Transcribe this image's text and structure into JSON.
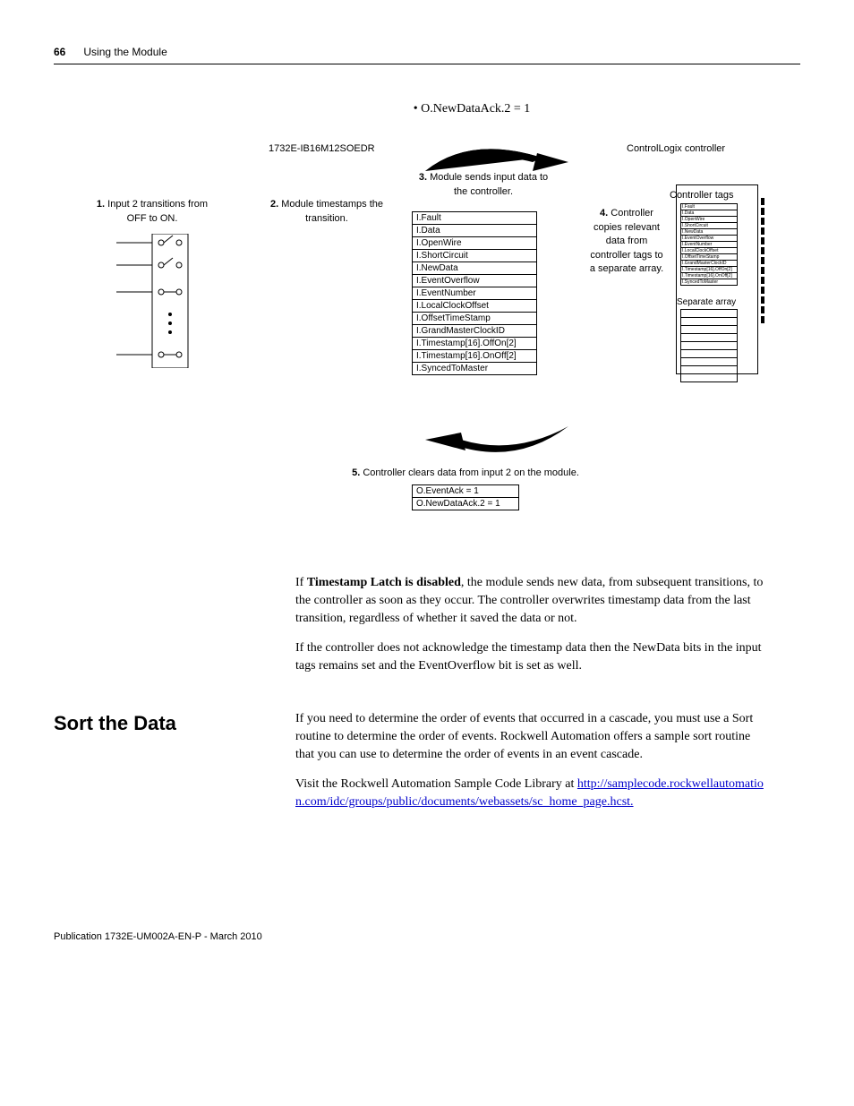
{
  "header": {
    "pagenum": "66",
    "running": "Using the Module"
  },
  "bullet": "• O.NewDataAck.2 = 1",
  "diagram": {
    "module_label": "1732E-IB16M12SOEDR",
    "controller_label": "ControlLogix controller",
    "step1_num": "1.",
    "step1_text": "Input 2 transitions from OFF to ON.",
    "step2_num": "2.",
    "step2_text": "Module timestamps the transition.",
    "step3_num": "3.",
    "step3_text": "Module sends input data to the controller.",
    "step4_num": "4.",
    "step4_text": "Controller copies relevant data from controller tags to a separate array.",
    "step5_num": "5.",
    "step5_text": "Controller clears data from input 2 on the module.",
    "input_tags": [
      "I.Fault",
      "I.Data",
      "I.OpenWire",
      "I.ShortCircuit",
      "I.NewData",
      "I.EventOverflow",
      "I.EventNumber",
      "I.LocalClockOffset",
      "I.OffsetTimeStamp",
      "I.GrandMasterClockID",
      "I.Timestamp[16].OffOn[2]",
      "I.Timestamp[16].OnOff[2]",
      "I.SyncedToMaster"
    ],
    "controller_tags_heading": "Controller tags",
    "controller_tags_small": [
      "I.Fault",
      "I.Data",
      "I.OpenWire",
      "I.ShortCircuit",
      "I.NewData",
      "I.EventOverflow",
      "I.EventNumber",
      "I.LocalClockOffset",
      "I.OffsetTimeStamp",
      "I.GrandMasterClockID",
      "I.Timestamp[16].OffOn[2]",
      "I.Timestamp[16].OnOff[2]",
      "I.SyncedToMaster"
    ],
    "separate_array_label": "Separate array",
    "output_tags": [
      "O.EventAck = 1",
      "O.NewDataAck.2 = 1"
    ]
  },
  "paragraphs": {
    "p1a": "If ",
    "p1b": "Timestamp Latch is disabled",
    "p1c": ", the module sends new data, from subsequent transitions, to the controller as soon as they occur. The controller overwrites timestamp data from the last transition, regardless of whether it saved the data or not.",
    "p2": "If the controller does not acknowledge the timestamp data then the NewData bits in the input tags remains set and the EventOverflow bit is set as well."
  },
  "section": {
    "heading": "Sort the Data",
    "body1": "If you need to determine the order of events that occurred in a cascade, you must use a Sort routine to determine the order of events. Rockwell Automation offers a sample sort routine that you can use to determine the order of events in an event cascade.",
    "body2": "Visit the Rockwell Automation Sample Code Library at ",
    "url": "http://samplecode.rockwellautomation.com/idc/groups/public/documents/webassets/sc_home_page.hcst."
  },
  "footer": "Publication 1732E-UM002A-EN-P - March 2010"
}
